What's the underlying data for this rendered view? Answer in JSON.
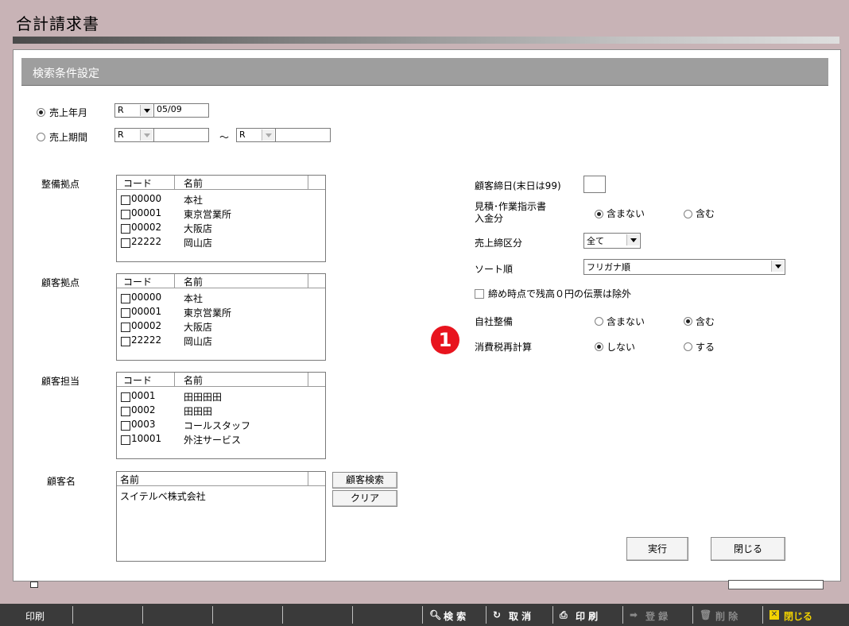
{
  "window": {
    "title": "合計請求書"
  },
  "section": {
    "title": "検索条件設定"
  },
  "sales_period": {
    "month_label": "売上年月",
    "period_label": "売上期間",
    "era": "R",
    "month_value": "05/09",
    "era_from": "R",
    "era_to": "R",
    "tilde": "～"
  },
  "lists": {
    "col_code": "コード",
    "col_name": "名前",
    "service_base": {
      "label": "整備拠点",
      "rows": [
        {
          "code": "00000",
          "name": "本社"
        },
        {
          "code": "00001",
          "name": "東京営業所"
        },
        {
          "code": "00002",
          "name": "大阪店"
        },
        {
          "code": "22222",
          "name": "岡山店"
        }
      ]
    },
    "customer_base": {
      "label": "顧客拠点",
      "rows": [
        {
          "code": "00000",
          "name": "本社"
        },
        {
          "code": "00001",
          "name": "東京営業所"
        },
        {
          "code": "00002",
          "name": "大阪店"
        },
        {
          "code": "22222",
          "name": "岡山店"
        }
      ]
    },
    "customer_rep": {
      "label": "顧客担当",
      "rows": [
        {
          "code": "0001",
          "name": "田田田田"
        },
        {
          "code": "0002",
          "name": "田田田"
        },
        {
          "code": "0003",
          "name": "コールスタッフ"
        },
        {
          "code": "10001",
          "name": "外注サービス"
        }
      ]
    },
    "customer_name": {
      "label": "顧客名",
      "col_name": "名前",
      "rows": [
        "スイテルベ株式会社"
      ]
    }
  },
  "buttons": {
    "customer_search": "顧客検索",
    "clear": "クリア",
    "execute": "実行",
    "close": "閉じる"
  },
  "options": {
    "closing_day_label": "顧客締日(末日は99)",
    "estimate_label_1": "見積･作業指示書",
    "estimate_label_2": "入金分",
    "exclude": "含まない",
    "include": "含む",
    "sales_close_label": "売上締区分",
    "sales_close_value": "全て",
    "sort_label": "ソート順",
    "sort_value": "フリガナ順",
    "zero_balance_label": "締め時点で残高０円の伝票は除外",
    "own_service_label": "自社整備",
    "tax_recalc_label": "消費税再計算",
    "no": "しない",
    "yes": "する"
  },
  "marker": "1",
  "taskbar": {
    "print": "印刷",
    "search": "検 索",
    "cancel": "取 消",
    "print2": "印 刷",
    "register": "登 録",
    "delete": "削 除",
    "close": "閉じる"
  }
}
